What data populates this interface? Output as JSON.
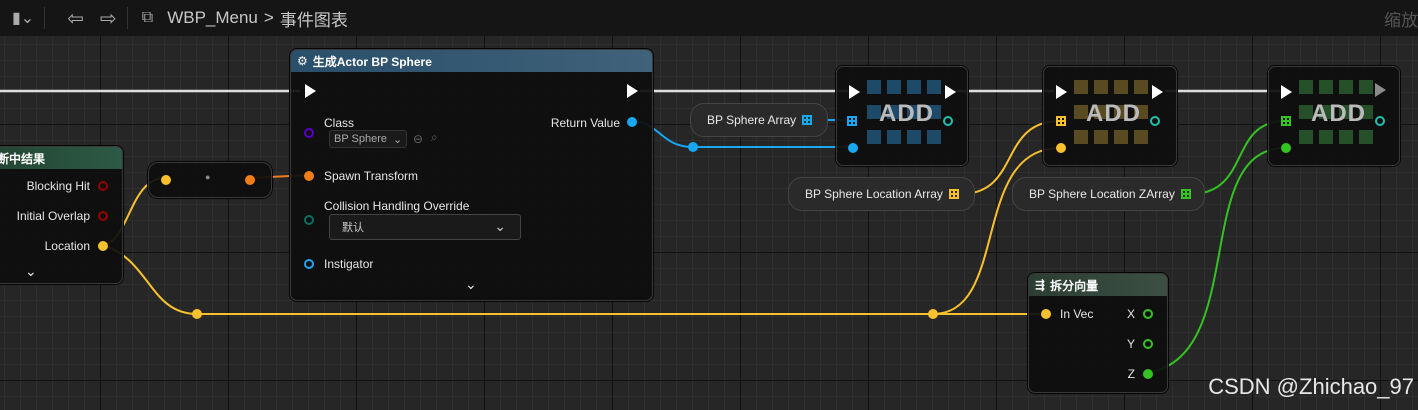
{
  "toolbar": {
    "breadcrumb_root": "WBP_Menu",
    "breadcrumb_sep": ">",
    "breadcrumb_current": "事件图表",
    "zoom_label": "缩放"
  },
  "hit_node": {
    "title": "断中结果",
    "pins": [
      "Blocking Hit",
      "Initial Overlap",
      "Location"
    ]
  },
  "reroute_node": {
    "dot": "●"
  },
  "spawn_node": {
    "title": "生成Actor BP Sphere",
    "class_label": "Class",
    "class_value": "BP Sphere",
    "spawn_transform": "Spawn Transform",
    "collision_label": "Collision Handling Override",
    "collision_value": "默认",
    "instigator": "Instigator",
    "return_value": "Return Value"
  },
  "variables": {
    "sphere_array": "BP Sphere Array",
    "location_array": "BP Sphere Location Array",
    "location_z_array": "BP Sphere Location ZArray"
  },
  "add_nodes": {
    "label": "ADD"
  },
  "break_node": {
    "title": "拆分向量",
    "in_vec": "In Vec",
    "x": "X",
    "y": "Y",
    "z": "Z"
  },
  "watermark": "CSDN @Zhichao_97",
  "colors": {
    "exec": "#ffffff",
    "object": "#18a7f0",
    "vector": "#f8c12d",
    "struct": "#f07d18",
    "float": "#35c223",
    "bool": "#950000",
    "class": "#5a00c8"
  }
}
